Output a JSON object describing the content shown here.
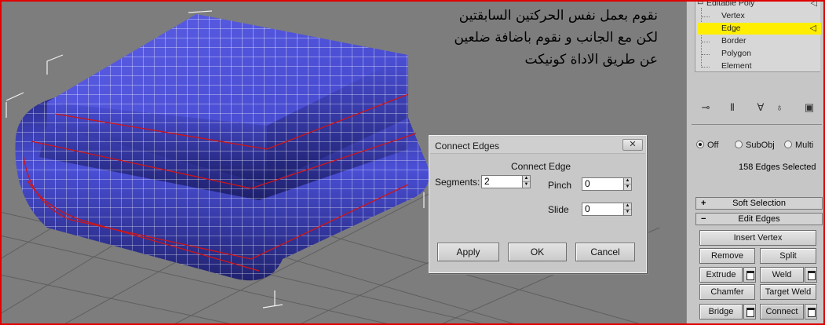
{
  "caption": {
    "line1": "نقوم بعمل نفس الحركتين السابقتين",
    "line2": "لكن مع الجانب و نقوم باضافة ضلعين",
    "line3": "عن طريق الاداة كونيكت"
  },
  "dialog": {
    "title": "Connect Edges",
    "close_icon": "close-icon",
    "group_label": "Connect Edge",
    "segments_label": "Segments:",
    "segments_value": "2",
    "pinch_label": "Pinch",
    "pinch_value": "0",
    "slide_label": "Slide",
    "slide_value": "0",
    "apply_label": "Apply",
    "ok_label": "OK",
    "cancel_label": "Cancel"
  },
  "modifier_stack": {
    "root": "Editable Poly",
    "items": [
      "Vertex",
      "Edge",
      "Border",
      "Polygon",
      "Element"
    ],
    "selected": "Edge"
  },
  "toolbar_icons": [
    "pin-stack-icon",
    "show-end-result-icon",
    "make-unique-icon",
    "remove-modifier-icon",
    "configure-modifier-sets-icon"
  ],
  "selection": {
    "radio_off": "Off",
    "radio_subobj": "SubObj",
    "radio_multi": "Multi",
    "selected_option": "Off",
    "status": "158 Edges Selected"
  },
  "rollouts": {
    "soft_selection": "Soft Selection",
    "soft_selection_sign": "+",
    "edit_edges": "Edit Edges",
    "edit_edges_sign": "−"
  },
  "edit_edges_buttons": {
    "insert_vertex": "Insert Vertex",
    "remove": "Remove",
    "split": "Split",
    "extrude": "Extrude",
    "weld": "Weld",
    "chamfer": "Chamfer",
    "target_weld": "Target Weld",
    "bridge": "Bridge",
    "connect": "Connect"
  },
  "colors": {
    "mesh": "#4a4fd6",
    "wire": "#ffffff",
    "selected_edge": "#d21414",
    "frame": "#e00000",
    "stack_highlight": "#ffee00"
  }
}
